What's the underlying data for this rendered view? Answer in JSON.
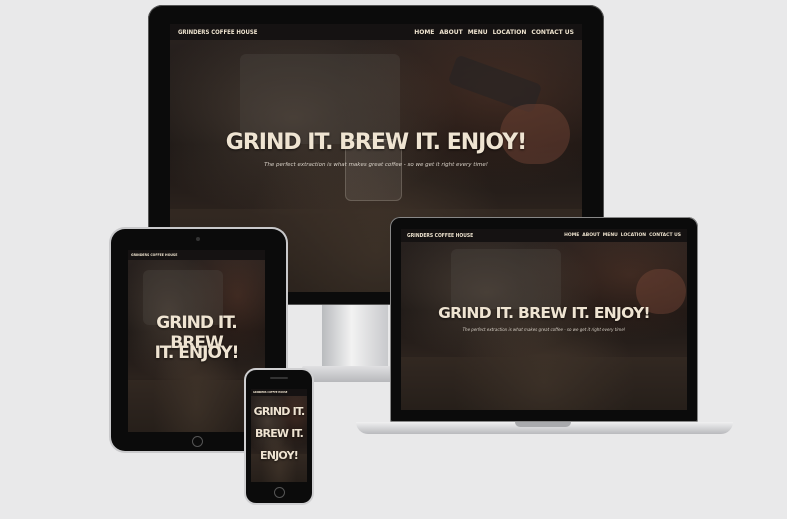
{
  "site": {
    "brand": "GRINDERS COFFEE HOUSE",
    "nav": [
      "HOME",
      "ABOUT",
      "MENU",
      "LOCATION",
      "CONTACT US"
    ],
    "headline": "GRIND IT. BREW IT. ENJOY!",
    "tablet_headline": [
      "GRIND IT. BREW",
      "IT. ENJOY!"
    ],
    "phone_headline": [
      "GRIND IT.",
      "BREW IT.",
      "ENJOY!"
    ],
    "subtitle": "The perfect extraction is what makes great coffee - so we get it right every time!"
  },
  "colors": {
    "page_bg": "#e9e9ea",
    "nav_bg": "#151212",
    "text_cream": "#efe4d2",
    "device_black": "#0b0b0b",
    "silver": "#cfd0d2"
  }
}
